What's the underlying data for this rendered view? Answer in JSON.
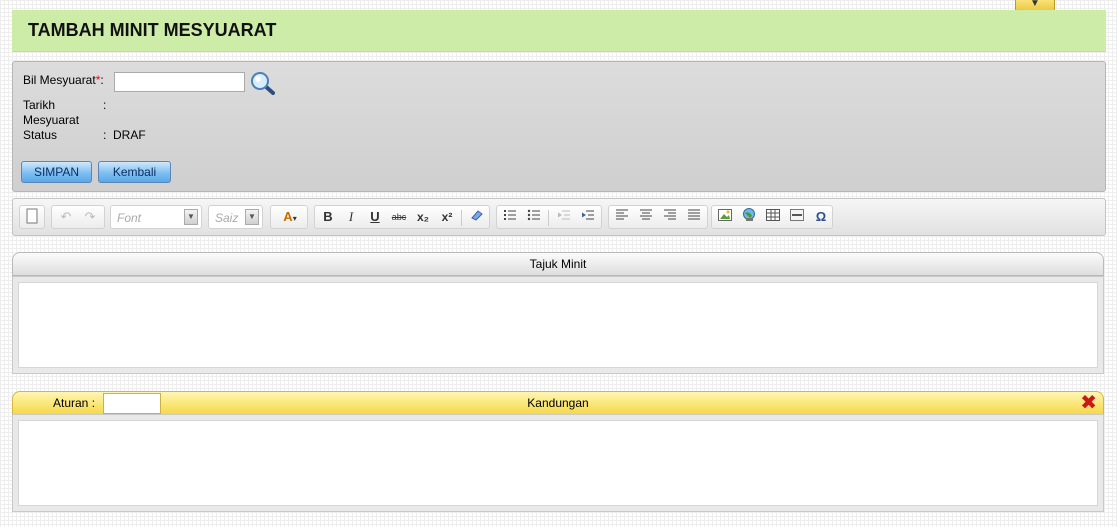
{
  "page": {
    "title": "TAMBAH MINIT MESYUARAT",
    "collapse_glyph": "▼"
  },
  "form": {
    "bil_label": "Bil Mesyuarat",
    "required_mark": "*",
    "bil_value": "",
    "tarikh_label_1": "Tarikh",
    "tarikh_label_2": "Mesyuarat",
    "tarikh_value": "",
    "status_label": "Status",
    "status_value": "DRAF",
    "colon": ":",
    "simpan_label": "SIMPAN",
    "kembali_label": "Kembali"
  },
  "toolbar": {
    "font_placeholder": "Font",
    "size_placeholder": "Saiz",
    "bold": "B",
    "italic": "I",
    "underline": "U",
    "strike": "abc",
    "subscript": "x₂",
    "superscript": "x²",
    "special_char": "Ω",
    "icons": [
      "new-page-icon",
      "undo-icon",
      "redo-icon",
      "font-color-icon",
      "bold-icon",
      "italic-icon",
      "underline-icon",
      "strikethrough-icon",
      "subscript-icon",
      "superscript-icon",
      "eraser-icon",
      "numbered-list-icon",
      "bullet-list-icon",
      "outdent-icon",
      "indent-icon",
      "align-left-icon",
      "align-center-icon",
      "align-right-icon",
      "justify-icon",
      "image-icon",
      "link-globe-icon",
      "table-icon",
      "horizontal-rule-icon",
      "omega-icon"
    ]
  },
  "panels": {
    "tajuk": {
      "header": "Tajuk Minit"
    },
    "kandungan": {
      "header": "Kandungan",
      "aturan_label": "Aturan :",
      "aturan_value": "",
      "close_glyph": "✖"
    }
  },
  "colors": {
    "title_bg": "#cdeca8",
    "button_blue": "#7fbef2",
    "kandungan_header": "#f6d84a",
    "close_red": "#c81818"
  }
}
